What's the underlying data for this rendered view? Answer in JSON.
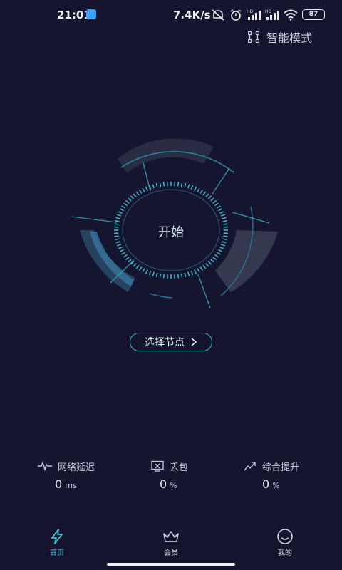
{
  "status_bar": {
    "time": "21:01",
    "net_speed": "7.4K/s",
    "battery": "87",
    "icons": [
      "notification-app-icon",
      "mute-icon",
      "alarm-icon",
      "hd-signal-icon",
      "hd-signal-icon",
      "wifi-icon",
      "battery-icon"
    ]
  },
  "header": {
    "smart_mode": "智能模式"
  },
  "dial": {
    "start": "开始"
  },
  "select_node": {
    "label": "选择节点"
  },
  "stats": {
    "latency": {
      "label": "网络延迟",
      "value": "0",
      "unit": "ms"
    },
    "packet_loss": {
      "label": "丢包",
      "value": "0",
      "unit": "%"
    },
    "boost": {
      "label": "综合提升",
      "value": "0",
      "unit": "%"
    }
  },
  "nav": {
    "home": "首页",
    "member": "会员",
    "mine": "我的"
  },
  "colors": {
    "background": "#151530",
    "accent": "#3fc4d6",
    "ring": "#2b8aa6"
  }
}
